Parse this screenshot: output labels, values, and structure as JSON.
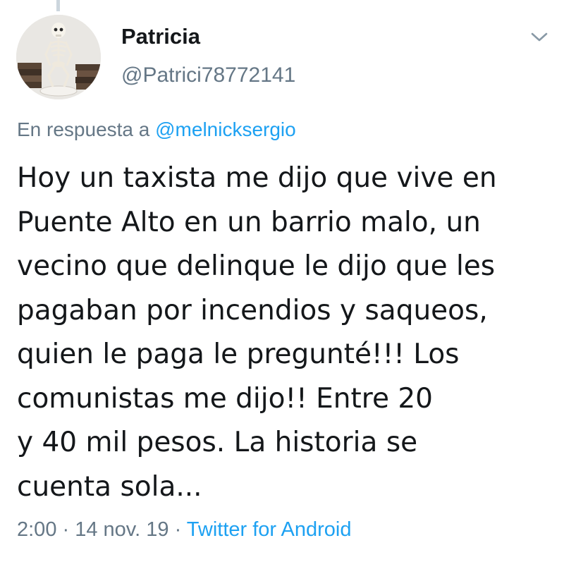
{
  "author": {
    "name": "Patricia",
    "handle": "@Patrici78772141"
  },
  "reply": {
    "prefix": "En respuesta a ",
    "mention": "@melnicksergio"
  },
  "tweet": {
    "lines": [
      "Hoy un taxista me dijo que vive en",
      "Puente Alto en un barrio malo, un",
      "vecino que delinque le dijo que les",
      "pagaban por incendios y saqueos,",
      "quien le paga le pregunté!!! Los",
      "comunistas me dijo!! Entre 20",
      "y 40 mil pesos. La historia se",
      "cuenta sola..."
    ]
  },
  "meta": {
    "time": "2:00",
    "separator": " · ",
    "date": "14 nov. 19",
    "source": "Twitter for Android"
  },
  "colors": {
    "text": "#14171a",
    "secondary": "#657786",
    "link": "#1da1f2"
  },
  "icons": {
    "menu": "chevron-down-icon",
    "avatar": "skeleton-figure-avatar"
  }
}
